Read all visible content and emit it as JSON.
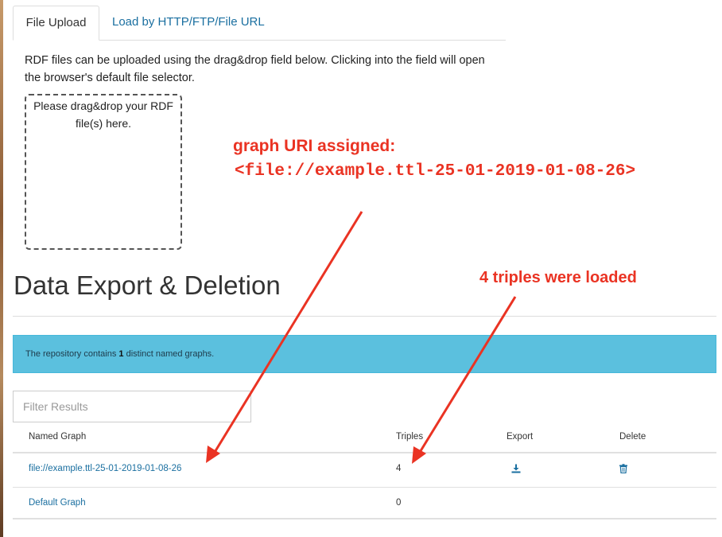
{
  "tabs": [
    {
      "label": "File Upload"
    },
    {
      "label": "Load by HTTP/FTP/File URL"
    }
  ],
  "upload": {
    "description": "RDF files can be uploaded using the drag&drop field below. Clicking into the field will open the browser's default file selector.",
    "dropzone_text": "Please drag&drop your RDF file(s) here."
  },
  "annotations": {
    "graph_uri_title": "graph URI assigned:",
    "graph_uri_value": "<file://example.ttl-25-01-2019-01-08-26>",
    "triples_loaded": "4 triples were loaded",
    "color": "#ea3323"
  },
  "section": {
    "title": "Data Export & Deletion"
  },
  "info": {
    "prefix": "The repository contains ",
    "count": "1",
    "suffix": " distinct named graphs.",
    "color": "#5bc0de"
  },
  "filter": {
    "placeholder": "Filter Results",
    "value": ""
  },
  "table": {
    "headers": [
      "Named Graph",
      "Triples",
      "Export",
      "Delete"
    ],
    "rows": [
      {
        "graph": "file://example.ttl-25-01-2019-01-08-26",
        "triples": "4",
        "export_icon": "download-icon",
        "delete_icon": "trash-icon"
      },
      {
        "graph": "Default Graph",
        "triples": "0"
      }
    ]
  }
}
